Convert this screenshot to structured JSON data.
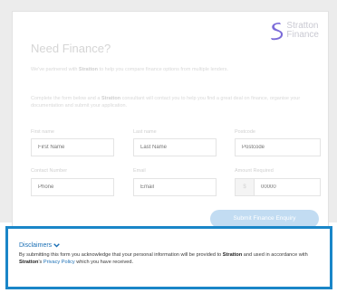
{
  "brand": {
    "line1": "Stratton",
    "line2": "Finance",
    "accent": "#7b6bd8"
  },
  "form": {
    "title": "Need Finance?",
    "intro_pre": "We've partnered with ",
    "intro_brand": "Stratton",
    "intro_post": " to help you compare finance options from multiple lenders.",
    "instr_pre": "Complete the form below and a ",
    "instr_brand": "Stratton",
    "instr_post": " consultant will contact you to help you find a great deal on finance, organise your documentation and submit your application.",
    "fields": {
      "first_name": {
        "label": "First name",
        "placeholder": "First Name"
      },
      "last_name": {
        "label": "Last name",
        "placeholder": "Last Name"
      },
      "postcode": {
        "label": "Postcode",
        "placeholder": "Postcode"
      },
      "contact": {
        "label": "Contact Number",
        "placeholder": "Phone"
      },
      "email": {
        "label": "Email",
        "placeholder": "Email"
      },
      "amount": {
        "label": "Amount Required",
        "prefix": "$",
        "placeholder": "00000"
      }
    },
    "submit_label": "Submit Finance Enquiry"
  },
  "disclaimer": {
    "title": "Disclaimers",
    "text_1": "By submitting this form you acknowledge that your personal information will be provided to ",
    "brand_1": "Stratton",
    "text_2": " and used in accordance with ",
    "brand_2": "Stratton",
    "text_3": "'s ",
    "link": "Privacy Policy",
    "text_4": " which you have received."
  }
}
